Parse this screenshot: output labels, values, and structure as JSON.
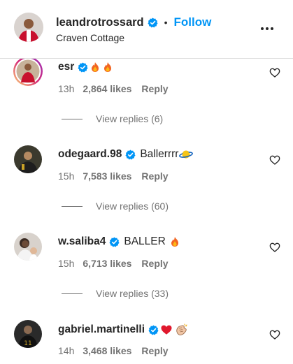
{
  "post_header": {
    "username": "leandrotrossard",
    "separator": "•",
    "follow_label": "Follow",
    "location": "Craven Cottage"
  },
  "comments": [
    {
      "username": "esr",
      "text": "",
      "emojis": [
        "fire-emoji",
        "fire-emoji"
      ],
      "time": "13h",
      "likes": "2,864 likes",
      "reply": "Reply",
      "view_replies": "View replies (6)"
    },
    {
      "username": "odegaard.98",
      "text": "Ballerrrr",
      "emojis": [
        "ringed-planet-emoji"
      ],
      "time": "15h",
      "likes": "7,583 likes",
      "reply": "Reply",
      "view_replies": "View replies (60)"
    },
    {
      "username": "w.saliba4",
      "text": "BALLER",
      "emojis": [
        "fire-emoji"
      ],
      "time": "15h",
      "likes": "6,713 likes",
      "reply": "Reply",
      "view_replies": "View replies (33)"
    },
    {
      "username": "gabriel.martinelli",
      "text": "",
      "emojis": [
        "red-heart-emoji",
        "clapping-hands-emoji"
      ],
      "time": "14h",
      "likes": "3,468 likes",
      "reply": "Reply"
    }
  ],
  "colors": {
    "accent": "#0095f6",
    "verified": "#0095f6",
    "secondary_text": "#737373",
    "primary_text": "#262626"
  }
}
